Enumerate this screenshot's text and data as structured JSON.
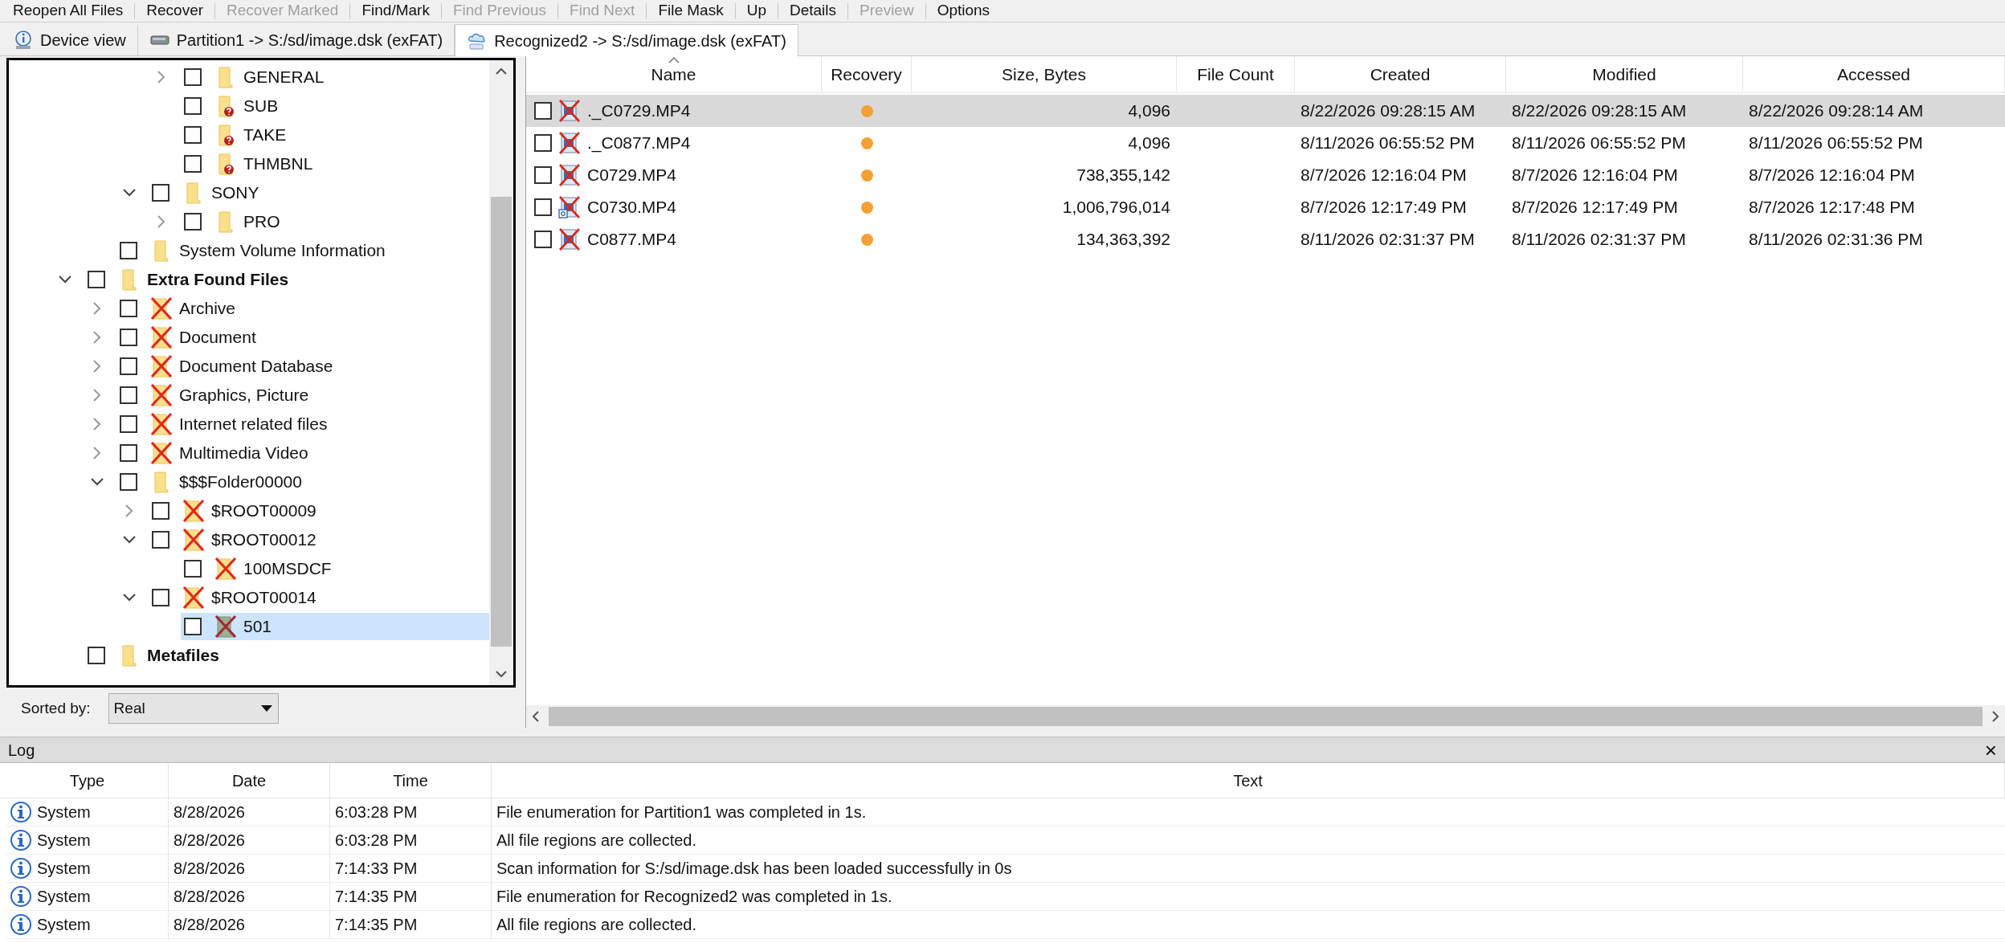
{
  "toolbar": [
    {
      "label": "Reopen All Files",
      "disabled": false
    },
    {
      "label": "Recover",
      "disabled": false
    },
    {
      "label": "Recover Marked",
      "disabled": true
    },
    {
      "label": "Find/Mark",
      "disabled": false
    },
    {
      "label": "Find Previous",
      "disabled": true
    },
    {
      "label": "Find Next",
      "disabled": true
    },
    {
      "label": "File Mask",
      "disabled": false
    },
    {
      "label": "Up",
      "disabled": false
    },
    {
      "label": "Details",
      "disabled": false
    },
    {
      "label": "Preview",
      "disabled": true
    },
    {
      "label": "Options",
      "disabled": false
    }
  ],
  "tabs": [
    {
      "label": "Device view",
      "kind": "device",
      "selected": false
    },
    {
      "label": "Partition1 -> S:/sd/image.dsk (exFAT)",
      "kind": "partition",
      "selected": false
    },
    {
      "label": "Recognized2 -> S:/sd/image.dsk (exFAT)",
      "kind": "recognized",
      "selected": true
    }
  ],
  "tree": {
    "items": [
      {
        "children": [
          {
            "children": [
              {
                "children": [
                  {
                    "label": "GENERAL",
                    "kind": "folder",
                    "expanded": false,
                    "checked": false,
                    "selected": false,
                    "bold": false
                  },
                  {
                    "label": "SUB",
                    "kind": "unknown",
                    "checked": false,
                    "selected": false,
                    "bold": false
                  },
                  {
                    "label": "TAKE",
                    "kind": "unknown",
                    "checked": false,
                    "selected": false,
                    "bold": false
                  },
                  {
                    "label": "THMBNL",
                    "kind": "unknown",
                    "checked": false,
                    "selected": false,
                    "bold": false
                  }
                ]
              },
              {
                "label": "SONY",
                "kind": "folder",
                "expanded": true,
                "checked": false,
                "selected": false,
                "bold": false,
                "children": [
                  {
                    "label": "PRO",
                    "kind": "folder",
                    "expanded": false,
                    "checked": false,
                    "selected": false,
                    "bold": false
                  }
                ]
              }
            ]
          },
          {
            "label": "System Volume Information",
            "kind": "folder",
            "checked": false,
            "selected": false,
            "bold": false
          }
        ]
      },
      {
        "label": "Extra Found Files",
        "kind": "folder",
        "expanded": true,
        "checked": false,
        "selected": false,
        "bold": true,
        "children": [
          {
            "label": "Archive",
            "kind": "lost",
            "expanded": false,
            "checked": false,
            "selected": false,
            "bold": false
          },
          {
            "label": "Document",
            "kind": "lost",
            "expanded": false,
            "checked": false,
            "selected": false,
            "bold": false
          },
          {
            "label": "Document Database",
            "kind": "lost",
            "expanded": false,
            "checked": false,
            "selected": false,
            "bold": false
          },
          {
            "label": "Graphics, Picture",
            "kind": "lost",
            "expanded": false,
            "checked": false,
            "selected": false,
            "bold": false
          },
          {
            "label": "Internet related files",
            "kind": "lost",
            "expanded": false,
            "checked": false,
            "selected": false,
            "bold": false
          },
          {
            "label": "Multimedia Video",
            "kind": "lost",
            "expanded": false,
            "checked": false,
            "selected": false,
            "bold": false
          },
          {
            "label": "$$$Folder00000",
            "kind": "folder",
            "expanded": true,
            "checked": false,
            "selected": false,
            "bold": false,
            "children": [
              {
                "label": "$ROOT00009",
                "kind": "lost",
                "expanded": false,
                "checked": false,
                "selected": false,
                "bold": false
              },
              {
                "label": "$ROOT00012",
                "kind": "lost",
                "expanded": true,
                "checked": false,
                "selected": false,
                "bold": false,
                "children": [
                  {
                    "label": "100MSDCF",
                    "kind": "lost",
                    "checked": false,
                    "selected": false,
                    "bold": false
                  }
                ]
              },
              {
                "label": "$ROOT00014",
                "kind": "lost",
                "expanded": true,
                "checked": false,
                "selected": false,
                "bold": false,
                "children": [
                  {
                    "label": "501",
                    "kind": "damaged",
                    "checked": false,
                    "selected": true,
                    "bold": false
                  }
                ]
              }
            ]
          }
        ]
      },
      {
        "label": "Metafiles",
        "kind": "folder",
        "checked": false,
        "selected": false,
        "bold": true
      }
    ]
  },
  "sort": {
    "label": "Sorted by:",
    "value": "Real"
  },
  "file_list": {
    "columns": [
      "Name",
      "Recovery",
      "Size, Bytes",
      "File Count",
      "Created",
      "Modified",
      "Accessed"
    ],
    "rows": [
      {
        "kind": "video",
        "name": "._C0729.MP4",
        "color": "#f5a033",
        "size": "4,096",
        "created": "8/22/2026 09:28:15 AM",
        "modified": "8/22/2026 09:28:15 AM",
        "accessed": "8/22/2026 09:28:14 AM",
        "checked": false,
        "selected": true
      },
      {
        "kind": "video",
        "name": "._C0877.MP4",
        "color": "#f5a033",
        "size": "4,096",
        "created": "8/11/2026 06:55:52 PM",
        "modified": "8/11/2026 06:55:52 PM",
        "accessed": "8/11/2026 06:55:52 PM",
        "checked": false,
        "selected": false
      },
      {
        "kind": "video",
        "name": "C0729.MP4",
        "color": "#f5a033",
        "size": "738,355,142",
        "created": "8/7/2026 12:16:04 PM",
        "modified": "8/7/2026 12:16:04 PM",
        "accessed": "8/7/2026 12:16:04 PM",
        "checked": false,
        "selected": false
      },
      {
        "kind": "linked",
        "name": "C0730.MP4",
        "color": "#f5a033",
        "size": "1,006,796,014",
        "created": "8/7/2026 12:17:49 PM",
        "modified": "8/7/2026 12:17:49 PM",
        "accessed": "8/7/2026 12:17:48 PM",
        "checked": false,
        "selected": false
      },
      {
        "kind": "video",
        "name": "C0877.MP4",
        "color": "#f5a033",
        "size": "134,363,392",
        "created": "8/11/2026 02:31:37 PM",
        "modified": "8/11/2026 02:31:37 PM",
        "accessed": "8/11/2026 02:31:36 PM",
        "checked": false,
        "selected": false
      }
    ]
  },
  "log": {
    "title": "Log",
    "close": "×",
    "columns": [
      "Type",
      "Date",
      "Time",
      "Text"
    ],
    "rows": [
      {
        "type": "System",
        "date": "8/28/2026",
        "time": "6:03:28 PM",
        "text": "File enumeration for Partition1 was completed in 1s."
      },
      {
        "type": "System",
        "date": "8/28/2026",
        "time": "6:03:28 PM",
        "text": "All file regions are collected."
      },
      {
        "type": "System",
        "date": "8/28/2026",
        "time": "7:14:33 PM",
        "text": "Scan information for S:/sd/image.dsk has been loaded successfully in 0s"
      },
      {
        "type": "System",
        "date": "8/28/2026",
        "time": "7:14:35 PM",
        "text": "File enumeration for Recognized2 was completed in 1s."
      },
      {
        "type": "System",
        "date": "8/28/2026",
        "time": "7:14:35 PM",
        "text": "All file regions are collected."
      }
    ]
  }
}
